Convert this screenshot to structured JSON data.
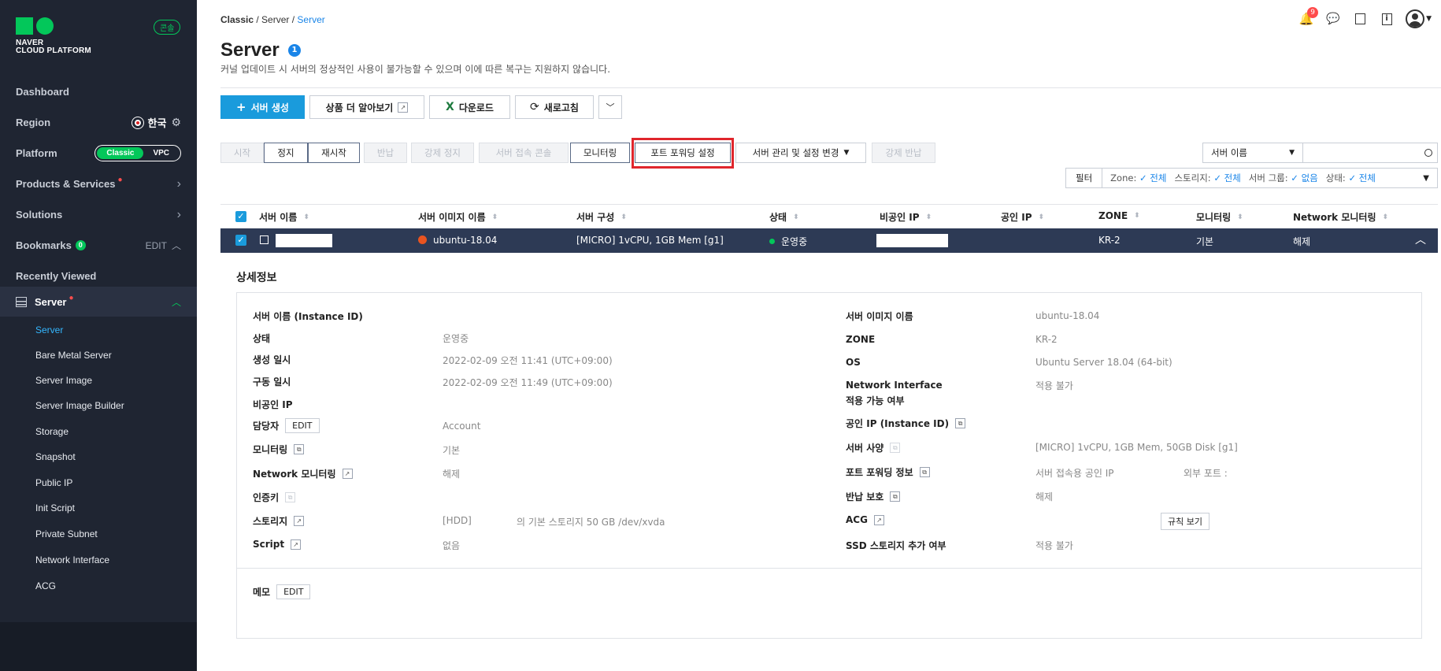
{
  "sidebar": {
    "brand_line1": "NAVER",
    "brand_line2": "CLOUD PLATFORM",
    "console_badge": "콘솔",
    "dashboard": "Dashboard",
    "region": "Region",
    "region_value": "한국",
    "platform": "Platform",
    "platform_classic": "Classic",
    "platform_vpc": "VPC",
    "products": "Products & Services",
    "solutions": "Solutions",
    "bookmarks": "Bookmarks",
    "bookmarks_count": "0",
    "bookmarks_edit": "EDIT",
    "recently_viewed": "Recently Viewed",
    "server": "Server",
    "sub_items": [
      "Server",
      "Bare Metal Server",
      "Server Image",
      "Server Image Builder",
      "Storage",
      "Snapshot",
      "Public IP",
      "Init Script",
      "Private Subnet",
      "Network Interface",
      "ACG"
    ]
  },
  "header": {
    "breadcrumb_1": "Classic",
    "breadcrumb_2": "Server",
    "breadcrumb_3": "Server",
    "notif_count": "9",
    "title": "Server",
    "title_badge": "1",
    "description": "커널 업데이트 시 서버의 정상적인 사용이 불가능할 수 있으며 이에 따른 복구는 지원하지 않습니다."
  },
  "toolbar": {
    "create": "서버 생성",
    "learn_more": "상품 더 알아보기",
    "download": "다운로드",
    "refresh": "새로고침"
  },
  "actions": {
    "start": "시작",
    "stop": "정지",
    "restart": "재시작",
    "return": "반납",
    "force_stop": "강제 정지",
    "console": "서버 접속 콘솔",
    "monitoring": "모니터링",
    "port_forwarding": "포트 포워딩 설정",
    "manage": "서버 관리 및 설정 변경",
    "force_return": "강제 반납"
  },
  "search": {
    "select_value": "서버 이름"
  },
  "filter": {
    "label": "필터",
    "zone_label": "Zone:",
    "zone_value": "전체",
    "storage_label": "스토리지:",
    "storage_value": "전체",
    "group_label": "서버 그룹:",
    "group_value": "없음",
    "status_label": "상태:",
    "status_value": "전체"
  },
  "table": {
    "columns": [
      "서버 이름",
      "서버 이미지 이름",
      "서버 구성",
      "상태",
      "비공인 IP",
      "공인 IP",
      "ZONE",
      "모니터링",
      "Network 모니터링"
    ],
    "row": {
      "image": "ubuntu-18.04",
      "spec": "[MICRO] 1vCPU, 1GB Mem [g1]",
      "status": "운영중",
      "zone": "KR-2",
      "monitoring": "기본",
      "net_monitoring": "해제"
    }
  },
  "detail": {
    "title": "상세정보",
    "left": {
      "name_label": "서버 이름 (Instance ID)",
      "status_label": "상태",
      "status_value": "운영중",
      "created_label": "생성 일시",
      "created_value": "2022-02-09 오전 11:41 (UTC+09:00)",
      "running_label": "구동 일시",
      "running_value": "2022-02-09 오전 11:49 (UTC+09:00)",
      "private_ip_label": "비공인 IP",
      "owner_label": "담당자",
      "owner_edit": "EDIT",
      "owner_value": "Account",
      "monitoring_label": "모니터링",
      "monitoring_value": "기본",
      "net_monitoring_label": "Network 모니터링",
      "net_monitoring_value": "해제",
      "auth_key_label": "인증키",
      "storage_label": "스토리지",
      "storage_type": "[HDD]",
      "storage_value": "의 기본 스토리지  50 GB /dev/xvda",
      "script_label": "Script",
      "script_value": "없음"
    },
    "right": {
      "image_label": "서버 이미지 이름",
      "image_value": "ubuntu-18.04",
      "zone_label": "ZONE",
      "zone_value": "KR-2",
      "os_label": "OS",
      "os_value": "Ubuntu Server 18.04 (64-bit)",
      "ni_label_1": "Network Interface",
      "ni_label_2": "적용 가능 여부",
      "ni_value": "적용 불가",
      "public_ip_label": "공인 IP (Instance ID)",
      "spec_label": "서버 사양",
      "spec_value": "[MICRO] 1vCPU, 1GB Mem, 50GB Disk [g1]",
      "port_label": "포트 포워딩 정보",
      "port_value": "서버 접속용 공인 IP",
      "port_external": "외부 포트 :",
      "return_protect_label": "반납 보호",
      "return_protect_value": "해제",
      "acg_label": "ACG",
      "acg_button": "규칙 보기",
      "ssd_label": "SSD 스토리지 추가 여부",
      "ssd_value": "적용 불가"
    },
    "memo_label": "메모",
    "memo_edit": "EDIT"
  },
  "colors": {
    "sidebar_bg": "#1f2532",
    "brand_green": "#03c75a",
    "primary_blue": "#1a9bdc",
    "selected_row": "#2d3a55",
    "highlight_red": "#e0262c"
  }
}
